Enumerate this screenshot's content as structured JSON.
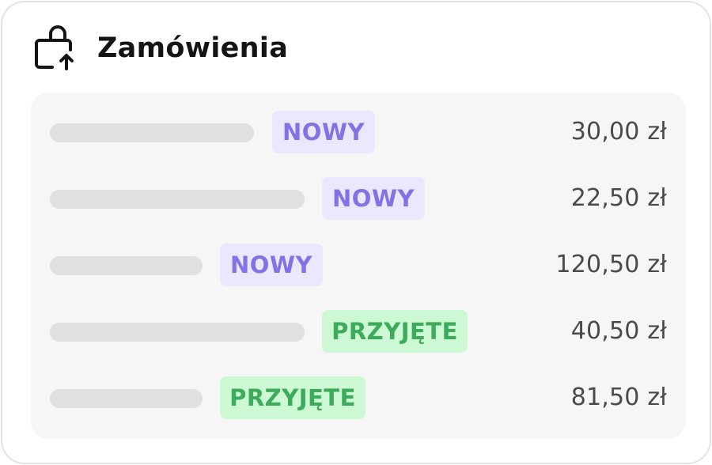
{
  "header": {
    "title": "Zamówienia",
    "icon": "shopping-bag-upload-icon"
  },
  "colors": {
    "status_new_bg": "#ebe7fd",
    "status_new_text": "#8471e5",
    "status_accepted_bg": "#cdf8d4",
    "status_accepted_text": "#3cab5a",
    "placeholder": "#e0e0e0",
    "panel_bg": "#f6f6f6"
  },
  "orders": [
    {
      "status": "NOWY",
      "price": "30,00 zł"
    },
    {
      "status": "NOWY",
      "price": "22,50 zł"
    },
    {
      "status": "NOWY",
      "price": "120,50 zł"
    },
    {
      "status": "PRZYJĘTE",
      "price": "40,50 zł"
    },
    {
      "status": "PRZYJĘTE",
      "price": "81,50 zł"
    }
  ]
}
